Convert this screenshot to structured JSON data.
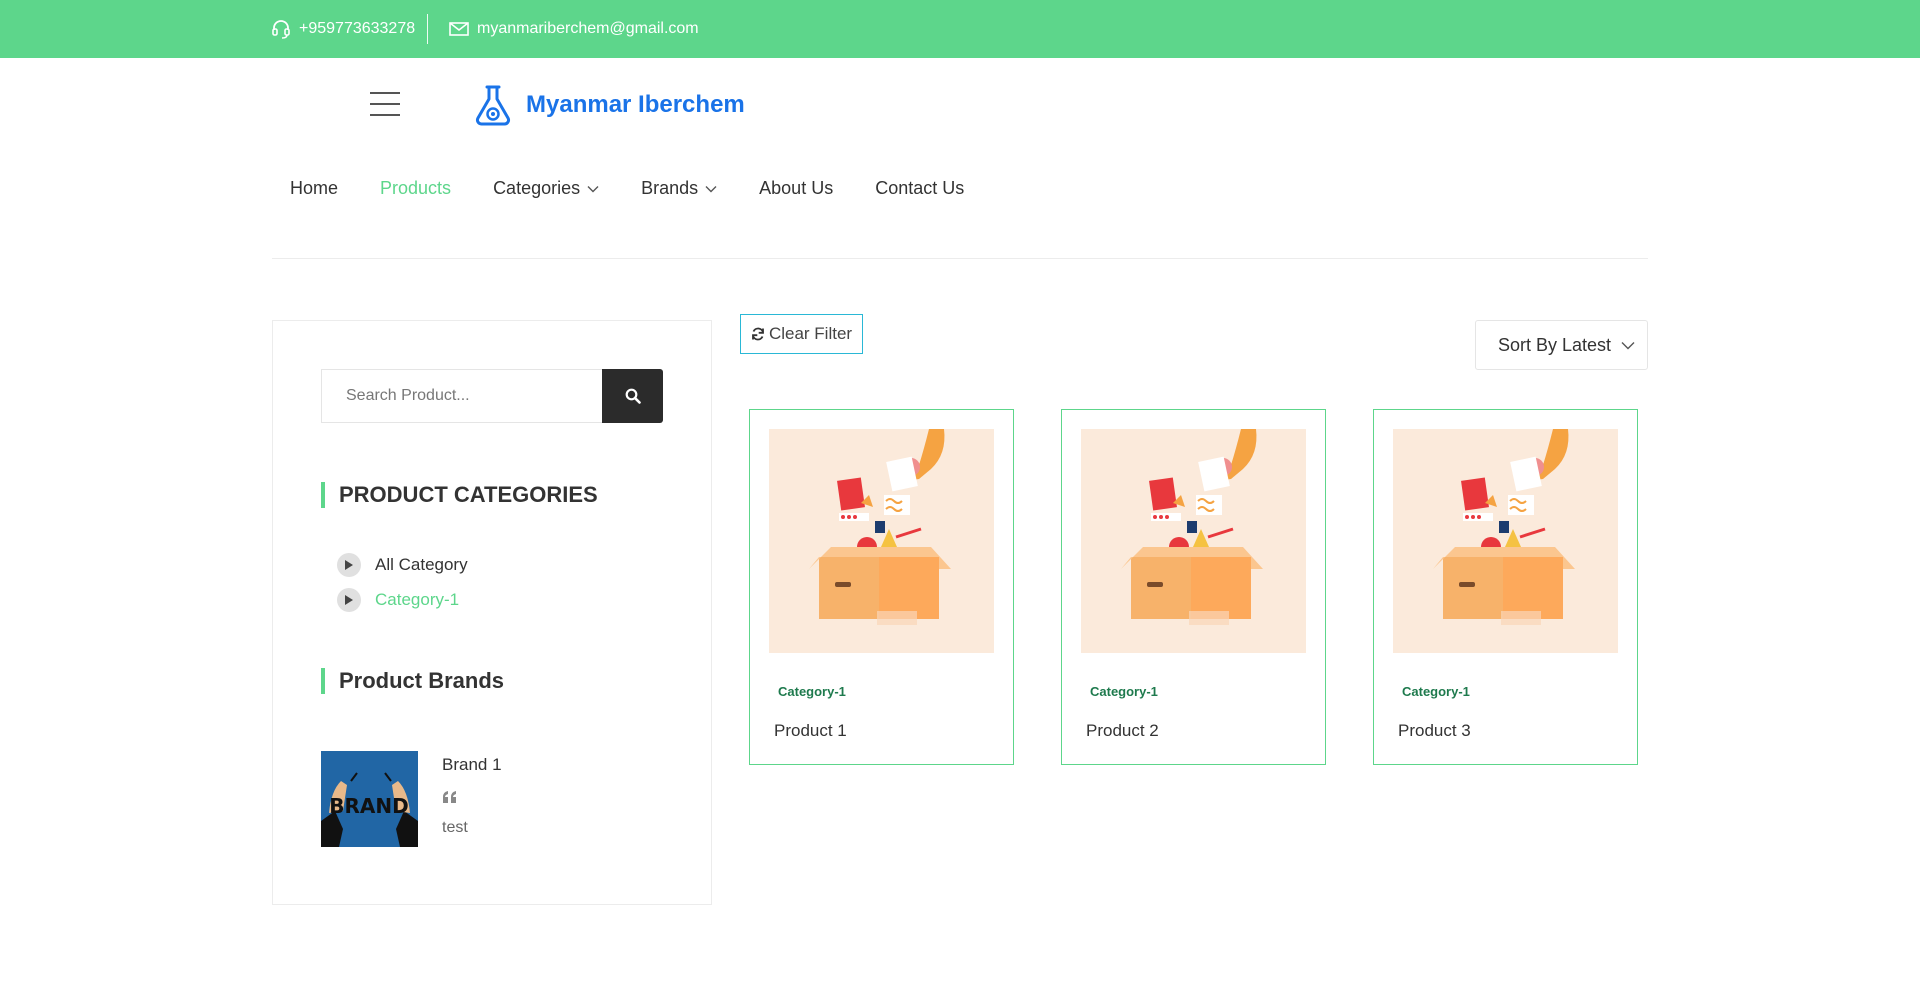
{
  "topbar": {
    "phone": "+959773633278",
    "email": "myanmariberchem@gmail.com",
    "phone_icon": "headset-icon",
    "email_icon": "envelope-icon",
    "bg_color": "#5dd68b"
  },
  "header": {
    "brand_name": "Myanmar Iberchem",
    "logo_icon": "flask-icon",
    "menu_icon": "hamburger-icon",
    "brand_color": "#1a73e8"
  },
  "nav": {
    "items": [
      {
        "label": "Home"
      },
      {
        "label": "Products",
        "active": true
      },
      {
        "label": "Categories",
        "dropdown": true
      },
      {
        "label": "Brands",
        "dropdown": true
      },
      {
        "label": "About Us"
      },
      {
        "label": "Contact Us"
      }
    ]
  },
  "sidebar": {
    "search_placeholder": "Search Product...",
    "categories_title": "PRODUCT CATEGORIES",
    "categories": [
      {
        "label": "All Category"
      },
      {
        "label": "Category-1",
        "active": true
      }
    ],
    "brands_title": "Product Brands",
    "brands": [
      {
        "name": "Brand 1",
        "logo_text": "BRAND",
        "description": "test",
        "quote_icon": "quote-icon"
      }
    ]
  },
  "toolbar": {
    "clear_filter": "Clear Filter",
    "sort_label": "Sort By Latest"
  },
  "products": [
    {
      "category": "Category-1",
      "name": "Product 1"
    },
    {
      "category": "Category-1",
      "name": "Product 2"
    },
    {
      "category": "Category-1",
      "name": "Product 3"
    }
  ]
}
